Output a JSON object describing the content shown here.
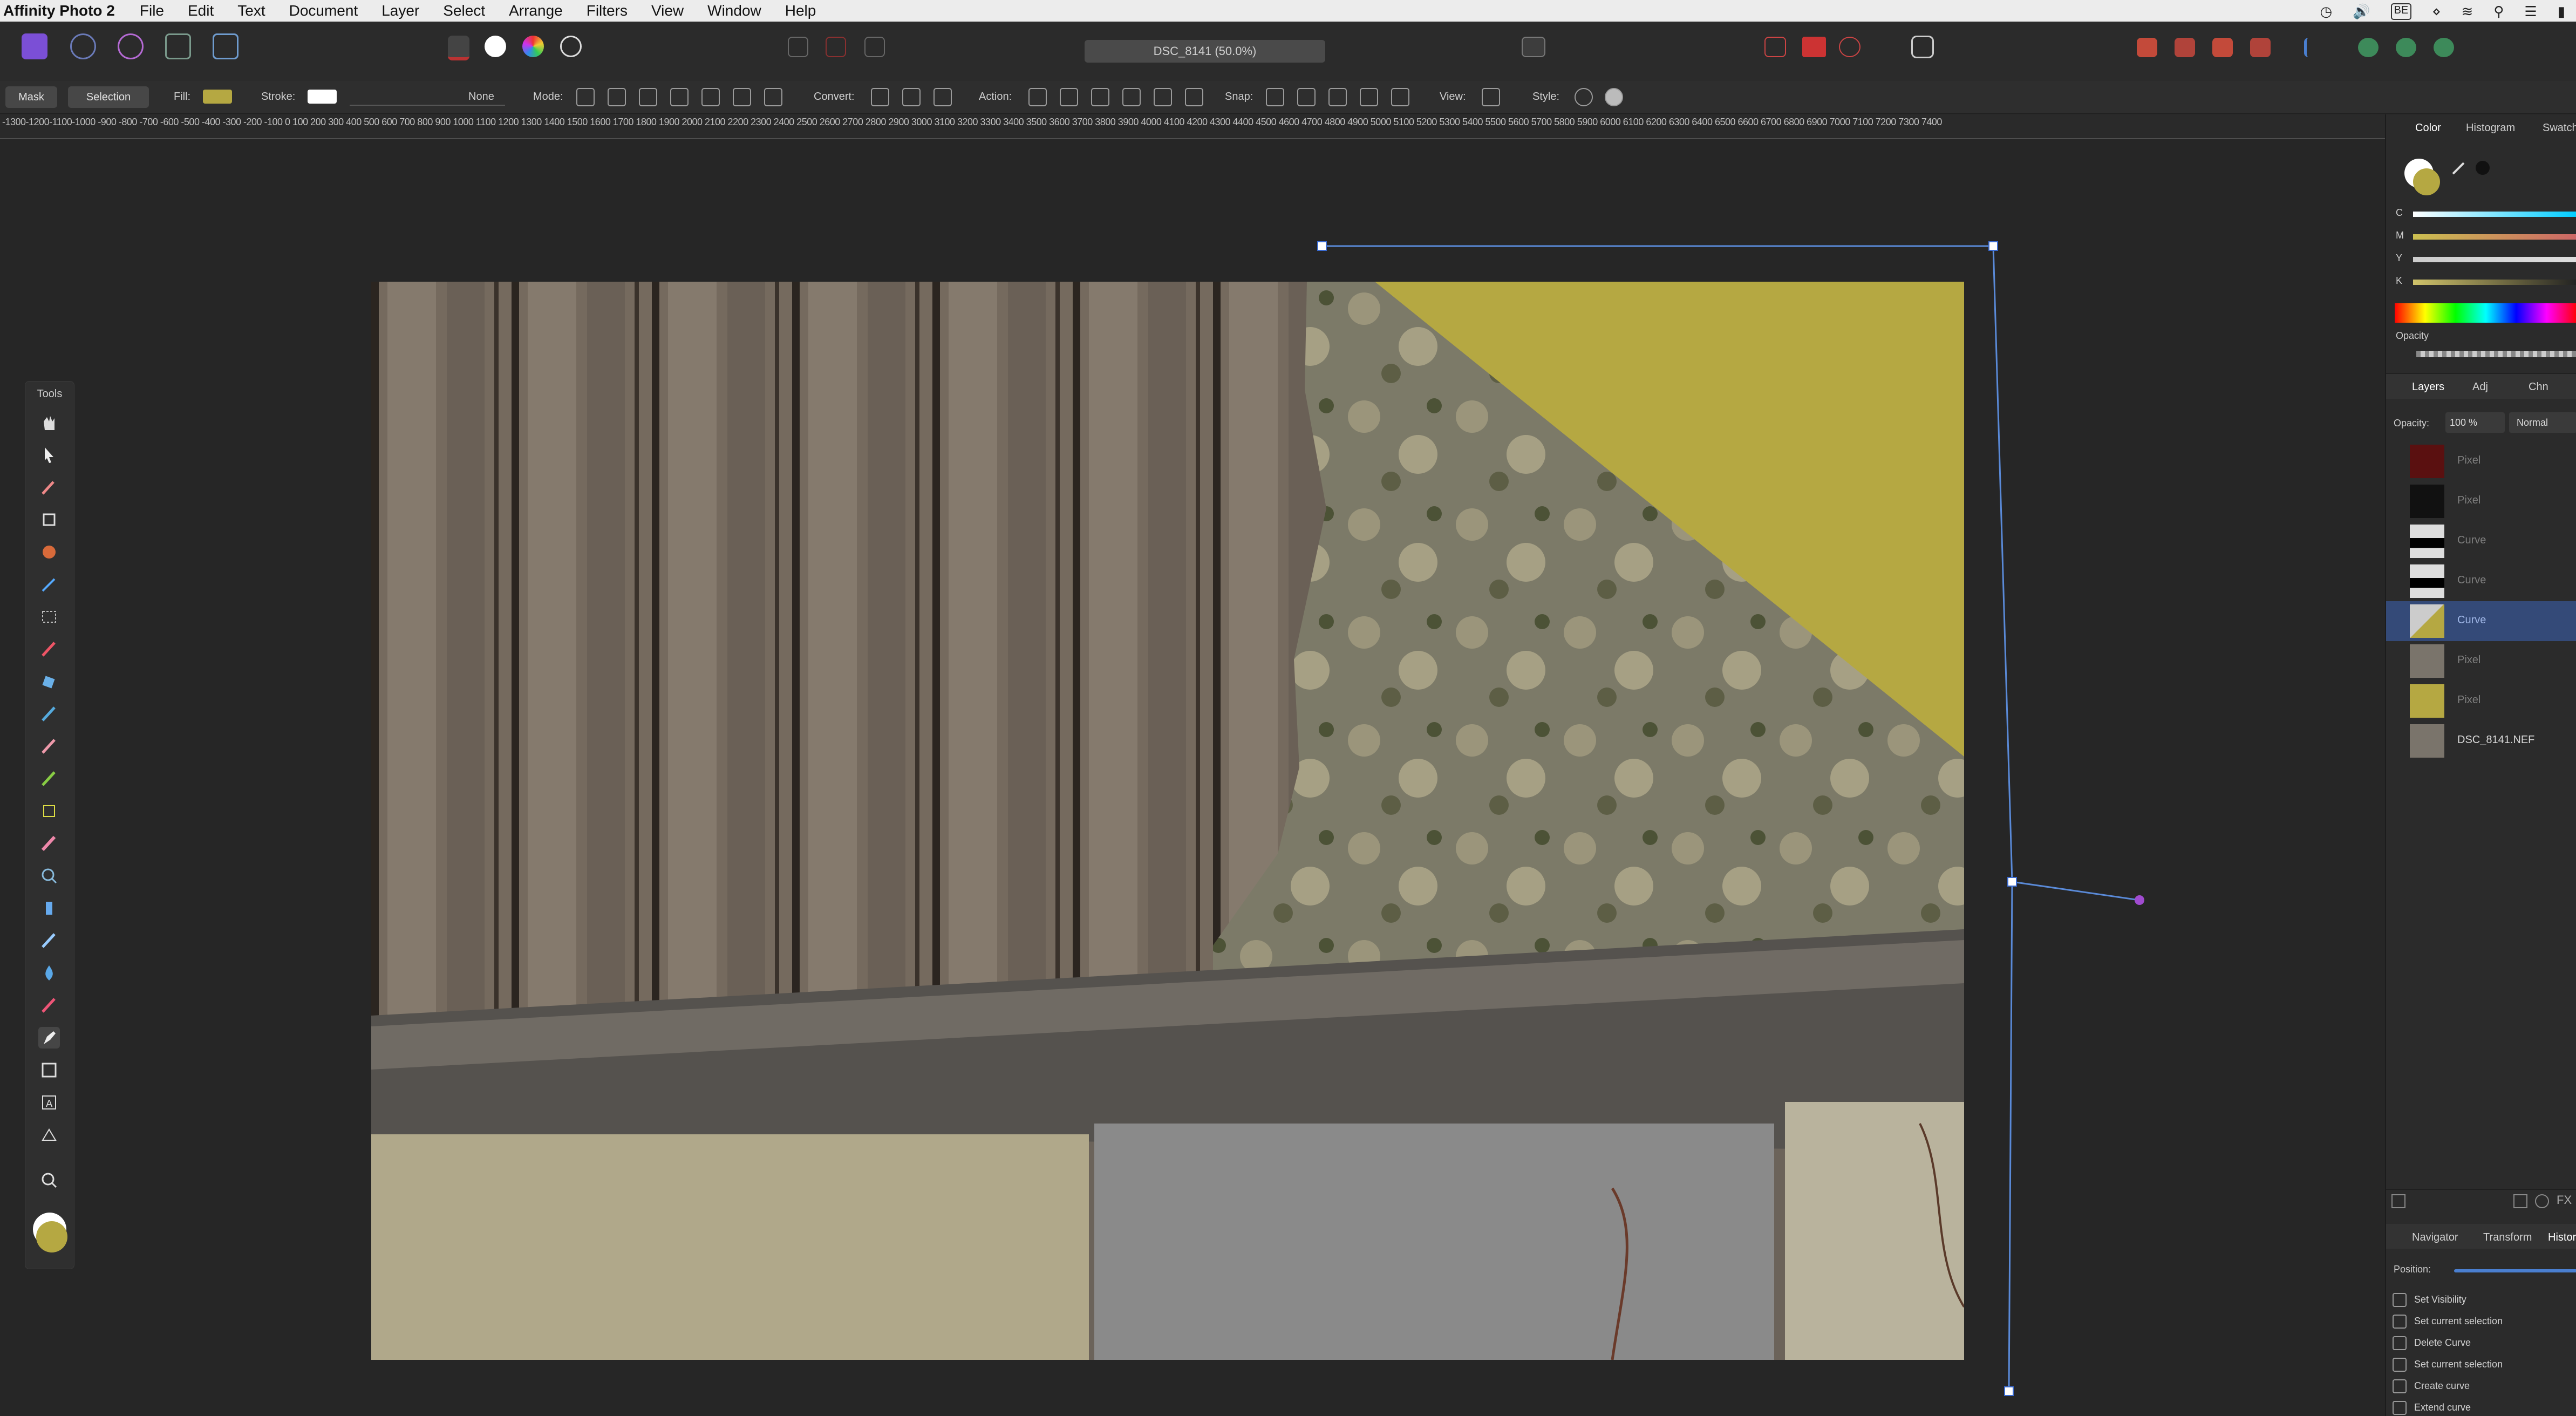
{
  "menubar": {
    "app": "Affinity Photo 2",
    "items": [
      "File",
      "Edit",
      "Text",
      "Document",
      "Layer",
      "Select",
      "Arrange",
      "Filters",
      "View",
      "Window",
      "Help"
    ],
    "input_badge": "BE"
  },
  "document": {
    "title": "DSC_8141 (50.0%)"
  },
  "context": {
    "mask": "Mask",
    "selection": "Selection",
    "fill": "Fill:",
    "fill_color": "#b5a842",
    "stroke": "Stroke:",
    "stroke_value": "None",
    "mode": "Mode:",
    "convert": "Convert:",
    "action": "Action:",
    "snap": "Snap:",
    "view": "View:",
    "style": "Style:"
  },
  "ruler": {
    "ticks": "-1300-1200-1100-1000 -900 -800 -700 -600 -500 -400 -300 -200 -100 0 100 200 300 400 500 600 700 800 900 1000 1100 1200 1300 1400 1500 1600 1700 1800 1900 2000 2100 2200 2300 2400 2500 2600 2700 2800 2900 3000 3100 3200 3300 3400 3500 3600 3700 3800 3900 4000 4100 4200 4300 4400 4500 4600 4700 4800 4900 5000 5100 5200 5300 5400 5500 5600 5700 5800 5900 6000 6100 6200 6300 6400 6500 6600 6700 6800 6900 7000 7100 7200 7300 7400"
  },
  "tools": {
    "title": "Tools"
  },
  "color_panel": {
    "tabs": [
      "Color",
      "Histogram",
      "Swatches"
    ],
    "channels": [
      "C",
      "M",
      "Y",
      "K"
    ],
    "opacity": "Opacity",
    "fill_color": "#b5a842"
  },
  "layers_panel": {
    "tabs": [
      "Layers",
      "Adj",
      "Chn"
    ],
    "opacity_label": "Opacity:",
    "opacity_value": "100 %",
    "blend": "Normal",
    "layers": [
      {
        "name": "Pixel",
        "selected": false
      },
      {
        "name": "Pixel",
        "selected": false
      },
      {
        "name": "Curve",
        "selected": false
      },
      {
        "name": "Curve",
        "selected": false
      },
      {
        "name": "Curve",
        "selected": true
      },
      {
        "name": "Pixel",
        "selected": false
      },
      {
        "name": "Pixel",
        "selected": false
      },
      {
        "name": "DSC_8141.NEF",
        "selected": false
      }
    ]
  },
  "bottom_panel": {
    "tabs": [
      "Navigator",
      "Transform",
      "Histor"
    ],
    "position": "Position:",
    "history": [
      "Set Visibility",
      "Set current selection",
      "Delete Curve",
      "Set current selection",
      "Create curve",
      "Extend curve"
    ]
  }
}
